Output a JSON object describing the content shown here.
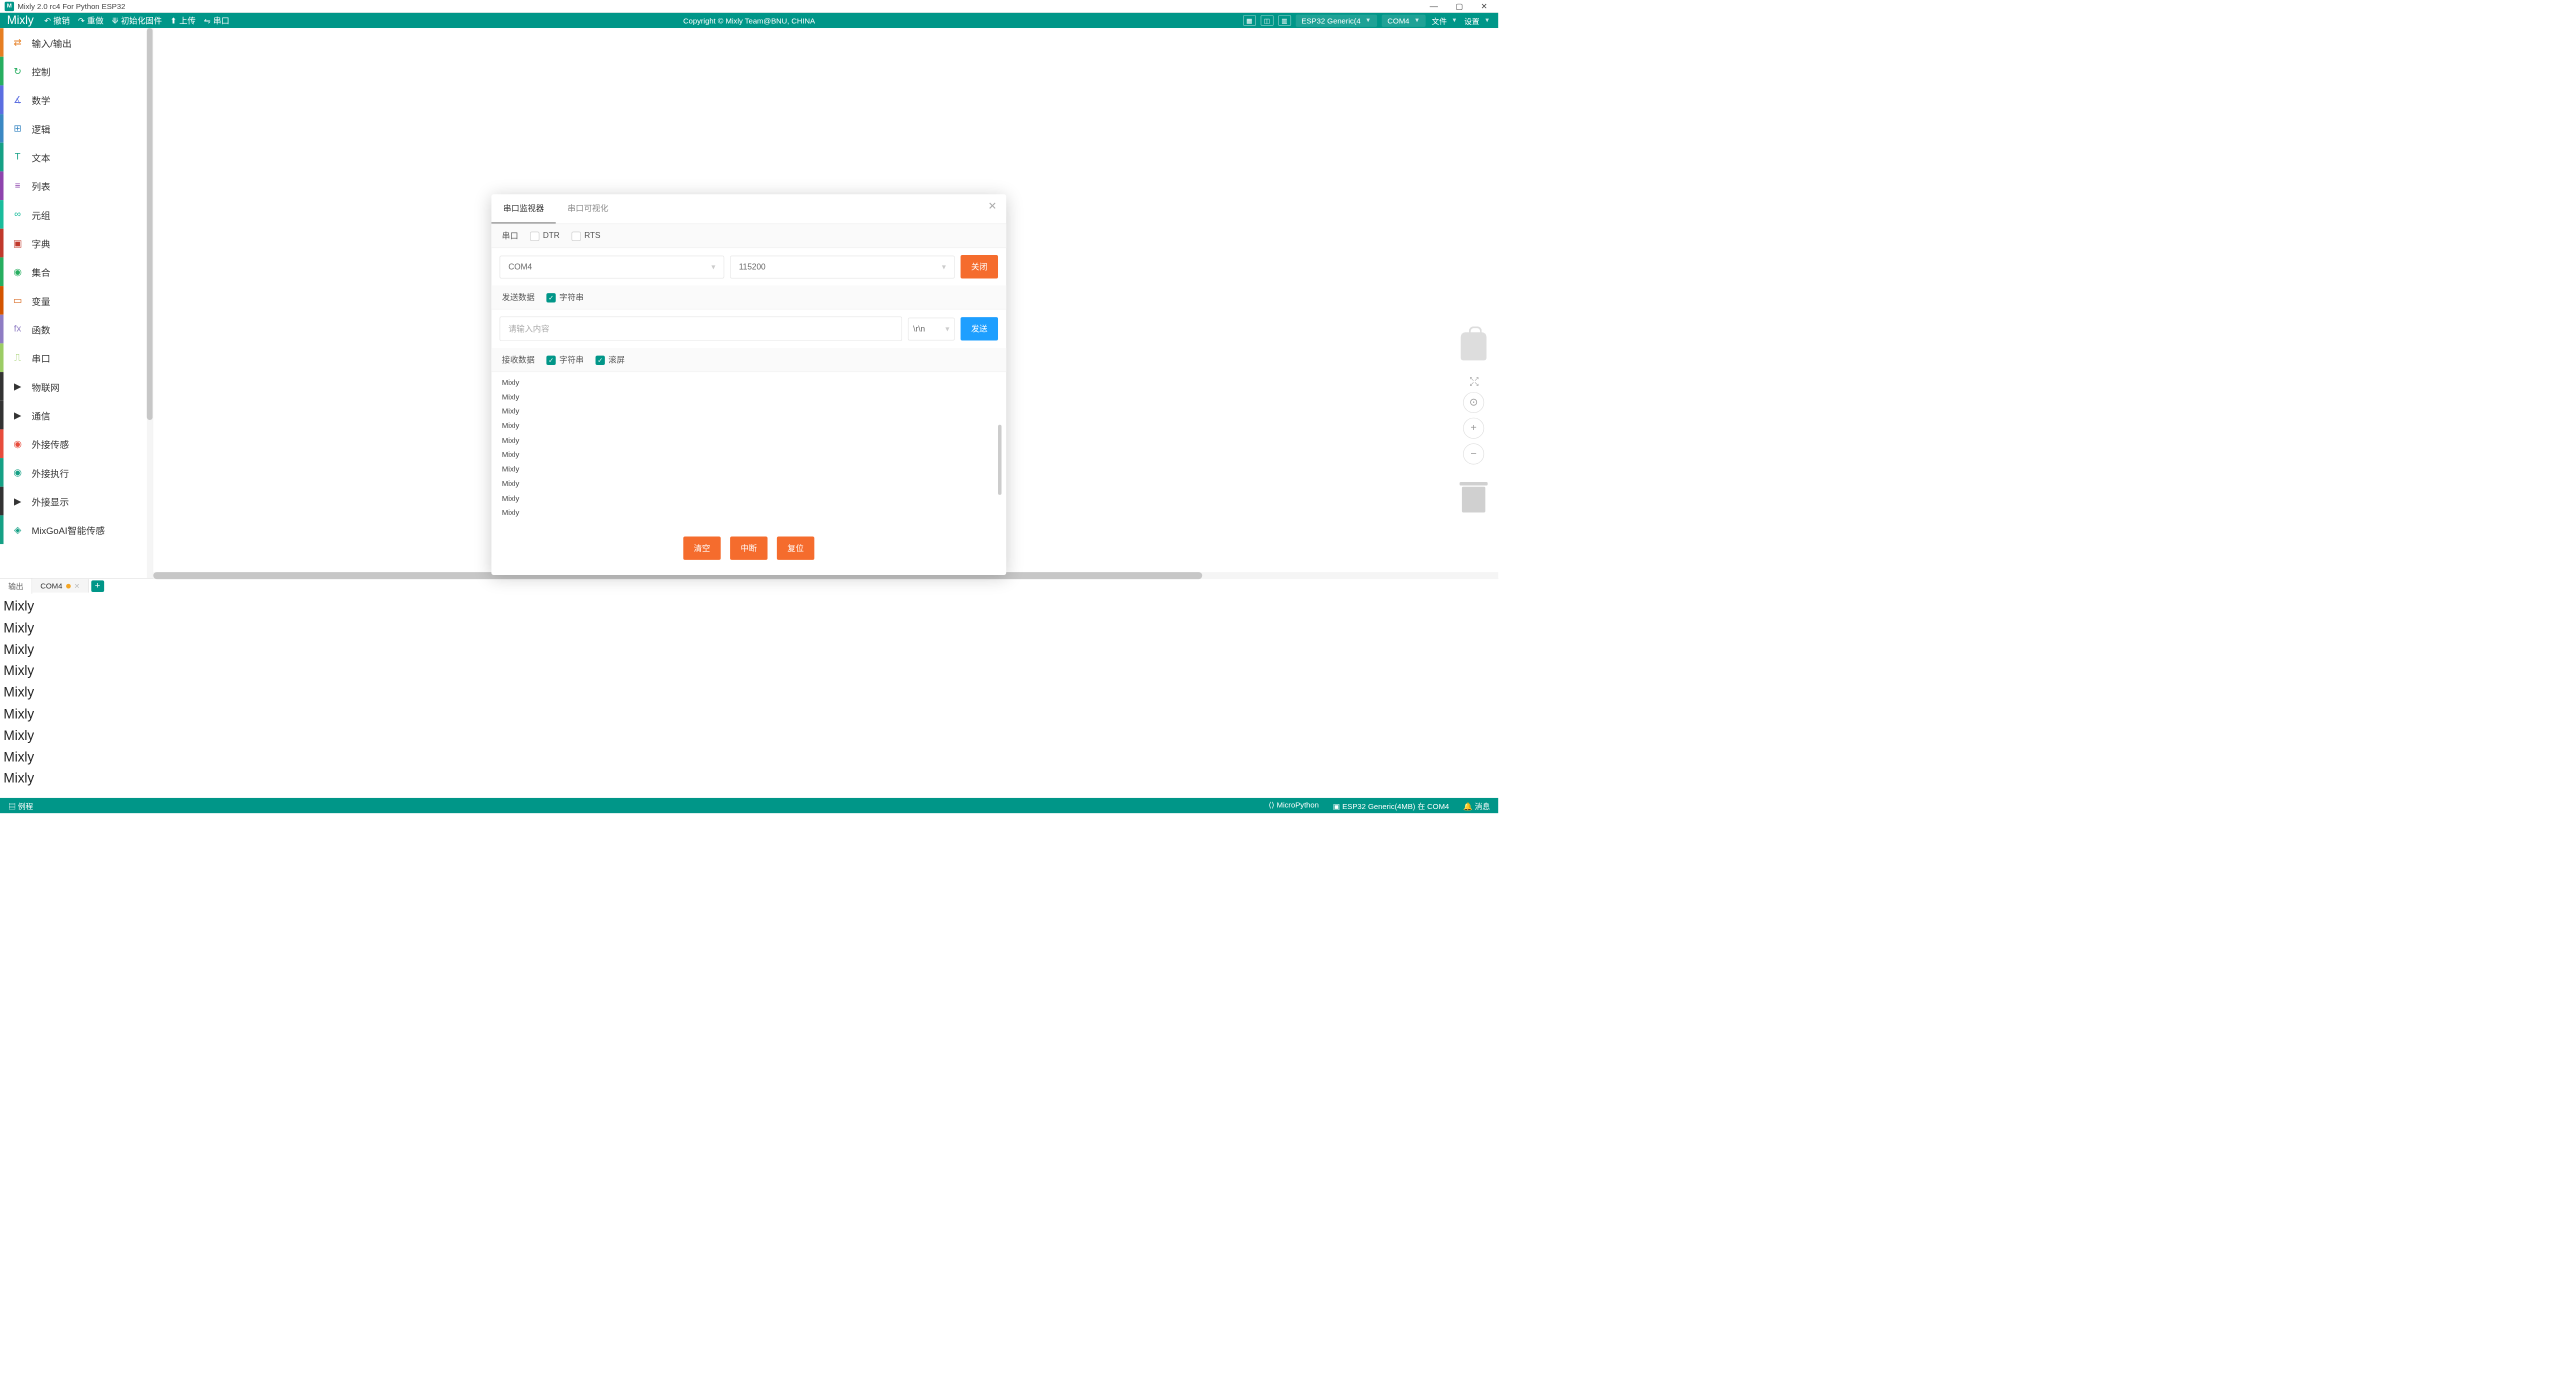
{
  "titlebar": {
    "title": "Mixly 2.0 rc4 For Python ESP32"
  },
  "topbar": {
    "brand": "Mixly",
    "undo": "撤销",
    "redo": "重做",
    "init": "初始化固件",
    "upload": "上传",
    "serial": "串口",
    "copyright": "Copyright © Mixly Team@BNU, CHINA",
    "board": "ESP32 Generic(4",
    "port": "COM4",
    "file": "文件",
    "settings": "设置"
  },
  "sidebar": {
    "items": [
      {
        "label": "输入/输出",
        "color": "#e67e22",
        "icon": "⇄"
      },
      {
        "label": "控制",
        "color": "#27ae60",
        "icon": "↻"
      },
      {
        "label": "数学",
        "color": "#5b6ee1",
        "icon": "∡"
      },
      {
        "label": "逻辑",
        "color": "#3b88c3",
        "icon": "⊞"
      },
      {
        "label": "文本",
        "color": "#16a085",
        "icon": "T"
      },
      {
        "label": "列表",
        "color": "#8e44ad",
        "icon": "≡"
      },
      {
        "label": "元组",
        "color": "#1abc9c",
        "icon": "∞"
      },
      {
        "label": "字典",
        "color": "#c0392b",
        "icon": "▣"
      },
      {
        "label": "集合",
        "color": "#27ae60",
        "icon": "◉"
      },
      {
        "label": "变量",
        "color": "#d35400",
        "icon": "▭"
      },
      {
        "label": "函数",
        "color": "#8e7cc3",
        "icon": "fx"
      },
      {
        "label": "串口",
        "color": "#9ccc65",
        "icon": "⎍"
      },
      {
        "label": "物联网",
        "color": "#333",
        "icon": "▶"
      },
      {
        "label": "通信",
        "color": "#333",
        "icon": "▶"
      },
      {
        "label": "外接传感",
        "color": "#e74c3c",
        "icon": "◉"
      },
      {
        "label": "外接执行",
        "color": "#16a085",
        "icon": "◉"
      },
      {
        "label": "外接显示",
        "color": "#333",
        "icon": "▶"
      },
      {
        "label": "MixGoAI智能传感",
        "color": "#16a085",
        "icon": "◈"
      }
    ]
  },
  "bottom_tabs": {
    "output": "输出",
    "com": "COM4"
  },
  "console_lines": [
    "Mixly",
    "Mixly",
    "Mixly",
    "Mixly",
    "Mixly",
    "Mixly",
    "Mixly",
    "Mixly",
    "Mixly"
  ],
  "statusbar": {
    "example": "例程",
    "lang": "MicroPython",
    "board_status": "ESP32 Generic(4MB) 在 COM4",
    "message": "消息"
  },
  "dialog": {
    "tab_monitor": "串口监视器",
    "tab_visual": "串口可视化",
    "serial_label": "串口",
    "dtr": "DTR",
    "rts": "RTS",
    "port": "COM4",
    "baud": "115200",
    "close": "关闭",
    "send_label": "发送数据",
    "string1": "字符串",
    "input_placeholder": "请输入内容",
    "terminator": "\\r\\n",
    "send": "发送",
    "recv_label": "接收数据",
    "string2": "字符串",
    "scroll": "滚屏",
    "recv_lines": [
      "Mixly",
      "Mixly",
      "Mixly",
      "Mixly",
      "Mixly",
      "Mixly",
      "Mixly",
      "Mixly",
      "Mixly",
      "Mixly"
    ],
    "clear": "清空",
    "interrupt": "中断",
    "reset": "复位"
  }
}
